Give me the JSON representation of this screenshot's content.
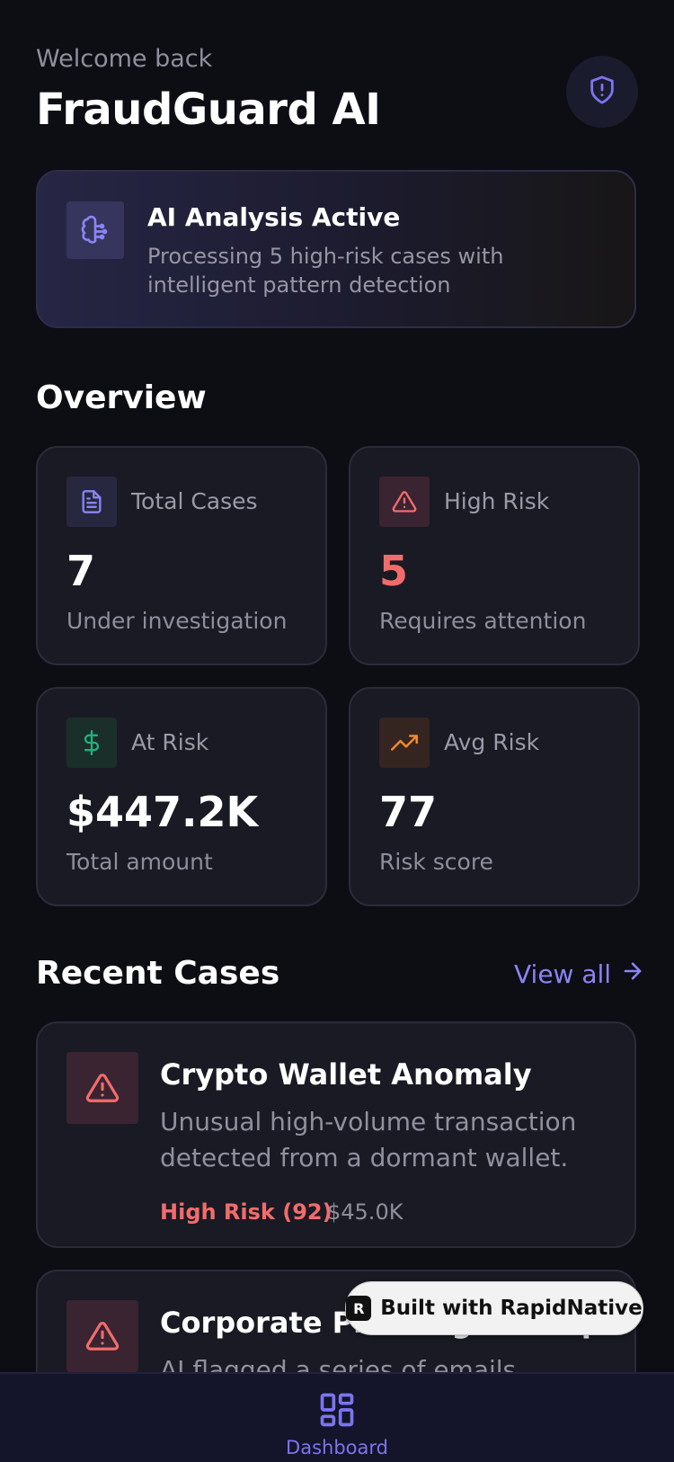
{
  "header": {
    "welcome": "Welcome back",
    "title": "FraudGuard AI"
  },
  "ai_banner": {
    "title": "AI Analysis Active",
    "description": "Processing 5 high-risk cases with intelligent pattern detection"
  },
  "overview": {
    "heading": "Overview",
    "stats": [
      {
        "label": "Total Cases",
        "value": "7",
        "sub": "Under investigation",
        "icon": "document-icon"
      },
      {
        "label": "High Risk",
        "value": "5",
        "sub": "Requires attention",
        "icon": "warning-icon"
      },
      {
        "label": "At Risk",
        "value": "$447.2K",
        "sub": "Total amount",
        "icon": "dollar-icon"
      },
      {
        "label": "Avg Risk",
        "value": "77",
        "sub": "Risk score",
        "icon": "trending-up-icon"
      }
    ]
  },
  "recent": {
    "heading": "Recent Cases",
    "view_all": "View all",
    "cases": [
      {
        "title": "Crypto Wallet Anomaly",
        "description": "Unusual high-volume transaction detected from a dormant wallet.",
        "risk": "High Risk (92)",
        "amount": "$45.0K"
      },
      {
        "title": "Corporate Phishing Attempt",
        "description": "AI flagged a series of emails"
      }
    ]
  },
  "badge": {
    "label": "Built with RapidNative"
  },
  "tabbar": {
    "items": [
      {
        "label": "Dashboard",
        "active": true
      }
    ]
  },
  "colors": {
    "accent": "#7c74f0",
    "danger": "#f26c6c",
    "success": "#22b07a",
    "warning": "#f08a2c",
    "background": "#0d0d14"
  }
}
